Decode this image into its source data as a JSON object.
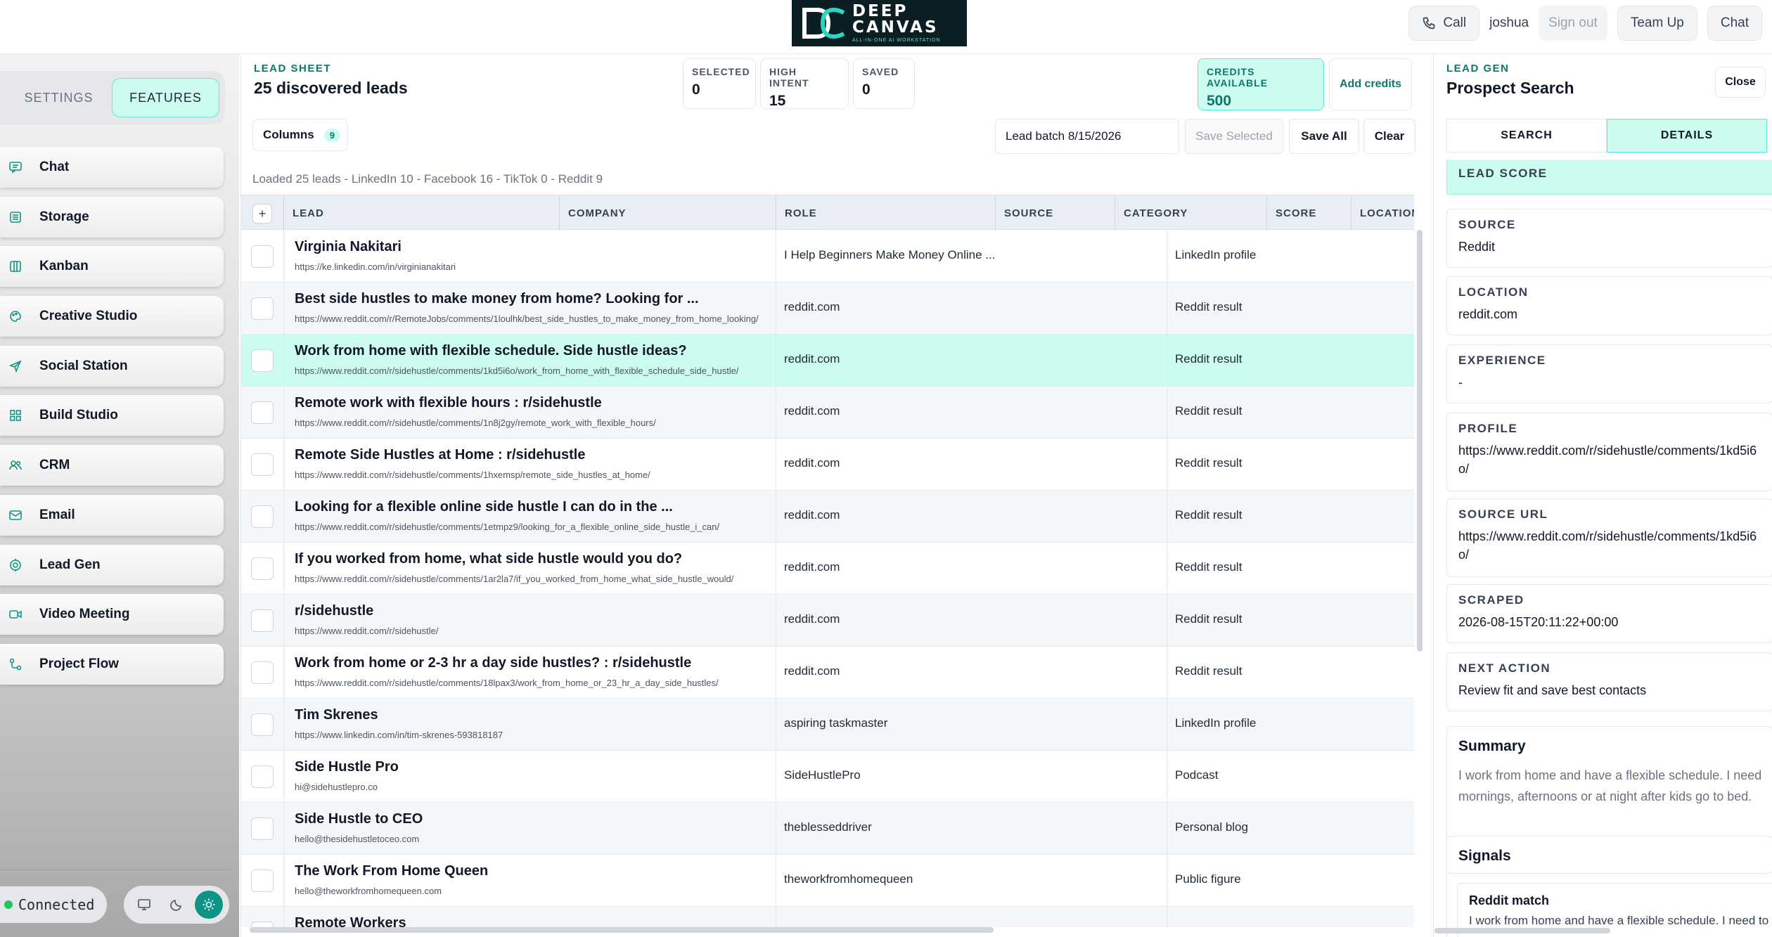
{
  "header": {
    "logo": {
      "word1": "DEEP",
      "word2": "CANVAS",
      "tagline": "ALL-IN-ONE AI WORKSTATION"
    },
    "call_label": "Call",
    "username": "joshua",
    "signout_label": "Sign out",
    "teamup_label": "Team Up",
    "chat_label": "Chat"
  },
  "sidebar": {
    "tabs": [
      {
        "label": "SETTINGS"
      },
      {
        "label": "FEATURES"
      }
    ],
    "active_tab": "FEATURES",
    "items": [
      {
        "label": "Chat",
        "icon": "chat-icon"
      },
      {
        "label": "Storage",
        "icon": "storage-icon"
      },
      {
        "label": "Kanban",
        "icon": "kanban-icon"
      },
      {
        "label": "Creative Studio",
        "icon": "palette-icon"
      },
      {
        "label": "Social Station",
        "icon": "send-icon"
      },
      {
        "label": "Build Studio",
        "icon": "grid-icon"
      },
      {
        "label": "CRM",
        "icon": "users-icon"
      },
      {
        "label": "Email",
        "icon": "mail-icon"
      },
      {
        "label": "Lead Gen",
        "icon": "target-icon"
      },
      {
        "label": "Video Meeting",
        "icon": "video-icon"
      },
      {
        "label": "Project Flow",
        "icon": "flow-icon"
      }
    ],
    "status_label": "Connected",
    "status_color": "#22c55e",
    "modes": [
      "monitor-icon",
      "moon-icon",
      "sun-icon"
    ],
    "active_mode": "sun-icon"
  },
  "sheet": {
    "eyebrow": "LEAD SHEET",
    "title": "25 discovered leads",
    "stats": [
      {
        "label": "SELECTED",
        "value": "0"
      },
      {
        "label": "HIGH INTENT",
        "value": "15"
      },
      {
        "label": "SAVED",
        "value": "0"
      }
    ],
    "credits": {
      "label": "CREDITS AVAILABLE",
      "value": "500"
    },
    "add_credits_label": "Add credits",
    "columns_label": "Columns",
    "columns_count": "9",
    "batch_name": "Lead batch 8/15/2026",
    "save_selected_label": "Save Selected",
    "save_all_label": "Save All",
    "clear_label": "Clear",
    "summary": "Loaded 25 leads - LinkedIn 10 - Facebook 16 - TikTok 0 - Reddit 9",
    "accent_color": "#0f766e",
    "columns": [
      "LEAD",
      "COMPANY",
      "ROLE",
      "SOURCE",
      "CATEGORY",
      "SCORE",
      "LOCATION"
    ],
    "rows": [
      {
        "name": "Virginia Nakitari",
        "url": "https://ke.linkedin.com/in/virginianakitari",
        "role": "I Help Beginners Make Money Online ...",
        "category": "LinkedIn profile"
      },
      {
        "name": "Best side hustles to make money from home? Looking for ...",
        "url": "https://www.reddit.com/r/RemoteJobs/comments/1loulhk/best_side_hustles_to_make_money_from_home_looking/",
        "role": "reddit.com",
        "category": "Reddit result"
      },
      {
        "name": "Work from home with flexible schedule. Side hustle ideas?",
        "url": "https://www.reddit.com/r/sidehustle/comments/1kd5i6o/work_from_home_with_flexible_schedule_side_hustle/",
        "role": "reddit.com",
        "category": "Reddit result",
        "selected": true
      },
      {
        "name": "Remote work with flexible hours : r/sidehustle",
        "url": "https://www.reddit.com/r/sidehustle/comments/1n8j2gy/remote_work_with_flexible_hours/",
        "role": "reddit.com",
        "category": "Reddit result"
      },
      {
        "name": "Remote Side Hustles at Home : r/sidehustle",
        "url": "https://www.reddit.com/r/sidehustle/comments/1hxemsp/remote_side_hustles_at_home/",
        "role": "reddit.com",
        "category": "Reddit result"
      },
      {
        "name": "Looking for a flexible online side hustle I can do in the ...",
        "url": "https://www.reddit.com/r/sidehustle/comments/1etmpz9/looking_for_a_flexible_online_side_hustle_i_can/",
        "role": "reddit.com",
        "category": "Reddit result"
      },
      {
        "name": "If you worked from home, what side hustle would you do?",
        "url": "https://www.reddit.com/r/sidehustle/comments/1ar2la7/if_you_worked_from_home_what_side_hustle_would/",
        "role": "reddit.com",
        "category": "Reddit result"
      },
      {
        "name": "r/sidehustle",
        "url": "https://www.reddit.com/r/sidehustle/",
        "role": "reddit.com",
        "category": "Reddit result"
      },
      {
        "name": "Work from home or 2-3 hr a day side hustles? : r/sidehustle",
        "url": "https://www.reddit.com/r/sidehustle/comments/18lpax3/work_from_home_or_23_hr_a_day_side_hustles/",
        "role": "reddit.com",
        "category": "Reddit result"
      },
      {
        "name": "Tim Skrenes",
        "url": "https://www.linkedin.com/in/tim-skrenes-593818187",
        "role": "aspiring taskmaster",
        "category": "LinkedIn profile"
      },
      {
        "name": "Side Hustle Pro",
        "url": "hi@sidehustlepro.co",
        "role": "SideHustlePro",
        "category": "Podcast"
      },
      {
        "name": "Side Hustle to CEO",
        "url": "hello@thesidehustletoceo.com",
        "role": "theblesseddriver",
        "category": "Personal blog"
      },
      {
        "name": "The Work From Home Queen",
        "url": "hello@theworkfromhomequeen.com",
        "role": "theworkfromhomequeen",
        "category": "Public figure"
      },
      {
        "name": "Remote Workers",
        "url": "",
        "role": "",
        "category": ""
      }
    ]
  },
  "panel": {
    "eyebrow": "LEAD GEN",
    "title": "Prospect Search",
    "close_label": "Close",
    "tabs": [
      "SEARCH",
      "DETAILS"
    ],
    "active_tab": "DETAILS",
    "lead_score_label": "LEAD SCORE",
    "fields": [
      {
        "label": "SOURCE",
        "value": "Reddit"
      },
      {
        "label": "LOCATION",
        "value": "reddit.com"
      },
      {
        "label": "EXPERIENCE",
        "value": "-"
      },
      {
        "label": "PROFILE",
        "value": "https://www.reddit.com/r/sidehustle/comments/1kd5i6o/"
      },
      {
        "label": "SOURCE URL",
        "value": "https://www.reddit.com/r/sidehustle/comments/1kd5i6o/"
      },
      {
        "label": "SCRAPED",
        "value": "2026-08-15T20:11:22+00:00"
      },
      {
        "label": "NEXT ACTION",
        "value": "Review fit and save best contacts"
      }
    ],
    "summary_title": "Summary",
    "summary_line1": "I work from home and have a flexible schedule. I need",
    "summary_line2": "mornings, afternoons or at night after kids go to bed.",
    "signals_title": "Signals",
    "signal_name": "Reddit match",
    "signal_text": "I work from home and have a flexible schedule. I need to"
  }
}
